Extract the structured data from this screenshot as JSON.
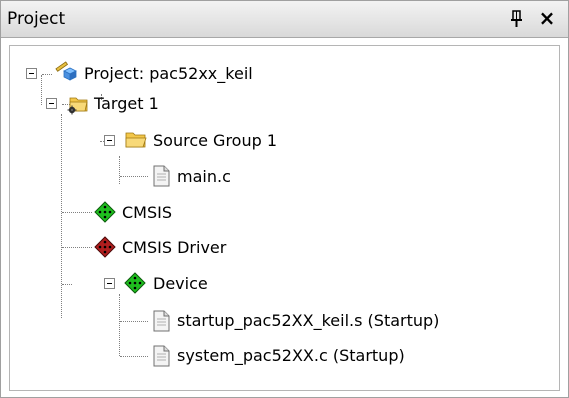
{
  "panel": {
    "title": "Project",
    "close_glyph": "×"
  },
  "tree": {
    "root": {
      "label": "Project: pac52xx_keil",
      "icon": "project-icon"
    },
    "target": {
      "label": "Target 1",
      "icon": "target-folder-icon"
    },
    "source_group": {
      "label": "Source Group 1",
      "icon": "folder-icon"
    },
    "main_c": {
      "label": "main.c",
      "icon": "file-icon"
    },
    "cmsis": {
      "label": "CMSIS",
      "icon": "component-green-icon"
    },
    "cmsis_driver": {
      "label": "CMSIS Driver",
      "icon": "component-red-icon"
    },
    "device": {
      "label": "Device",
      "icon": "component-green-icon"
    },
    "startup": {
      "label": "startup_pac52XX_keil.s (Startup)",
      "icon": "file-icon"
    },
    "system": {
      "label": "system_pac52XX.c (Startup)",
      "icon": "file-icon"
    }
  },
  "colors": {
    "component_green": "#1fbf1f",
    "component_red": "#b01e1e",
    "folder": "#f0c040"
  }
}
